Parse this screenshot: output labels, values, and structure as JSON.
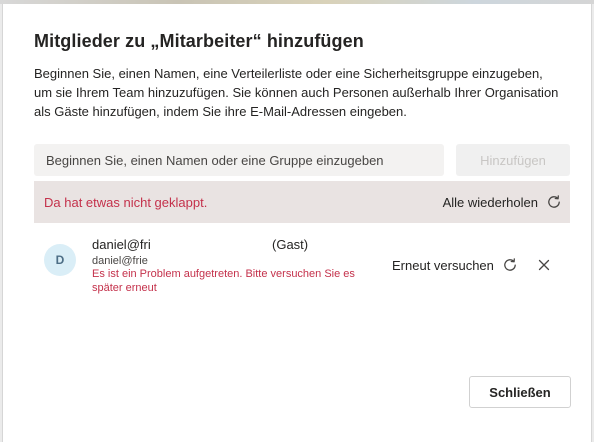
{
  "dialog": {
    "title": "Mitglieder zu „Mitarbeiter“ hinzufügen",
    "description": "Beginnen Sie, einen Namen, eine Verteilerliste oder eine Sicherheitsgruppe einzugeben, um sie Ihrem Team hinzuzufügen. Sie können auch Personen außerhalb Ihrer Organisation als Gäste hinzufügen, indem Sie ihre E-Mail-Adressen eingeben.",
    "search": {
      "placeholder": "Beginnen Sie, einen Namen oder eine Gruppe einzugeben",
      "value": ""
    },
    "add_button_label": "Hinzufügen",
    "error_banner": {
      "message": "Da hat etwas nicht geklappt.",
      "retry_all_label": "Alle wiederholen"
    },
    "member": {
      "avatar_initial": "D",
      "name": "daniel@fri",
      "tag": "(Gast)",
      "email": "daniel@frie",
      "error": "Es ist ein Problem aufgetreten. Bitte versuchen Sie es später erneut",
      "retry_label": "Erneut versuchen"
    },
    "close_button_label": "Schließen"
  },
  "colors": {
    "error_text": "#c4314b",
    "error_banner_bg": "#e9e3e2",
    "avatar_bg": "#daeef7",
    "disabled_text": "#c8c6c4"
  },
  "icons": {
    "refresh": "refresh-icon",
    "remove": "close-icon"
  }
}
